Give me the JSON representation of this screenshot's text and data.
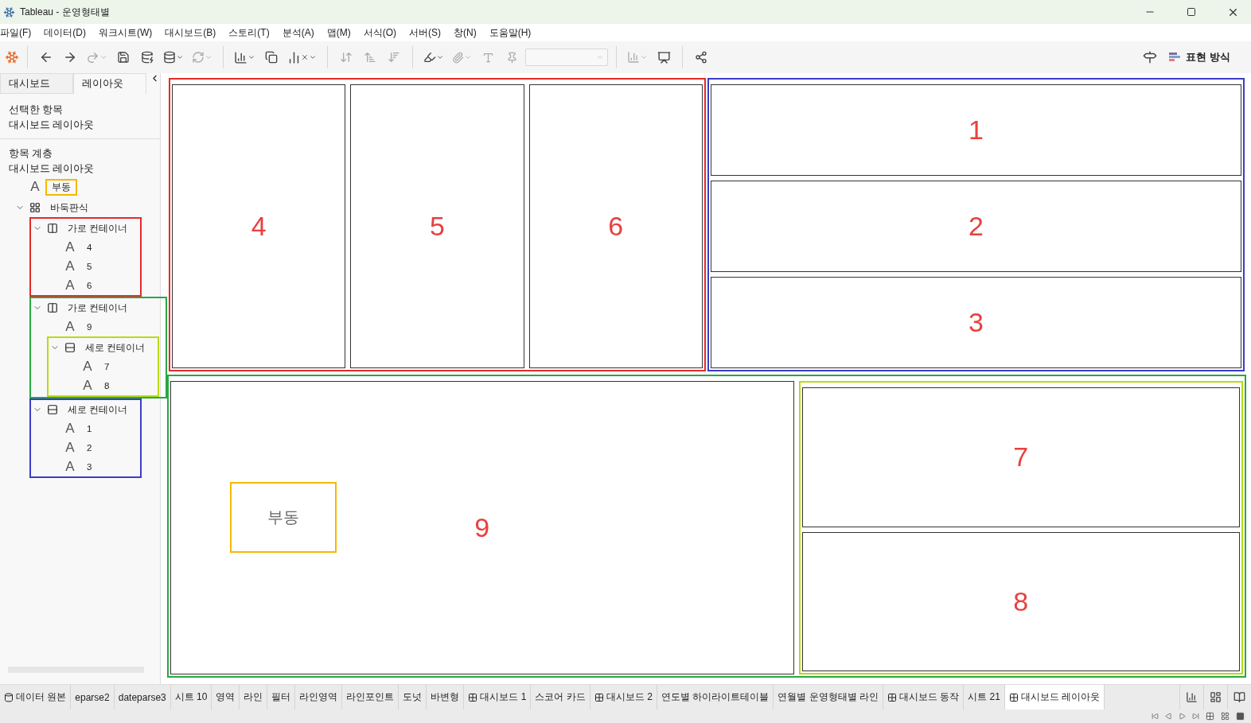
{
  "window": {
    "title": "Tableau - 운영형태별"
  },
  "menu": [
    "파일(F)",
    "데이터(D)",
    "워크시트(W)",
    "대시보드(B)",
    "스토리(T)",
    "분석(A)",
    "맵(M)",
    "서식(O)",
    "서버(S)",
    "창(N)",
    "도움말(H)"
  ],
  "toolbar": {
    "show_me": "표현 방식"
  },
  "sidebar": {
    "tabs": [
      {
        "label": "대시보드",
        "selected": false
      },
      {
        "label": "레이아웃",
        "selected": true
      }
    ],
    "selected_heading": "선택한 항목",
    "selected_value": "대시보드 레이아웃",
    "hierarchy_heading": "항목 계층",
    "hierarchy_root": "대시보드 레이아웃",
    "tree": [
      {
        "kind": "text",
        "icon": "A",
        "label": "부동",
        "color": "#f5b800"
      },
      {
        "kind": "tiled",
        "label": "바둑판식",
        "expanded": true,
        "children": [
          {
            "kind": "horizontal",
            "label": "가로 컨테이너",
            "expanded": true,
            "color": "#e52a2a",
            "children": [
              {
                "kind": "text",
                "icon": "A",
                "label": "4"
              },
              {
                "kind": "text",
                "icon": "A",
                "label": "5"
              },
              {
                "kind": "text",
                "icon": "A",
                "label": "6"
              }
            ]
          },
          {
            "kind": "horizontal",
            "label": "가로 컨테이너",
            "expanded": true,
            "color": "#27a844",
            "children": [
              {
                "kind": "text",
                "icon": "A",
                "label": "9"
              },
              {
                "kind": "vertical",
                "label": "세로 컨테이너",
                "expanded": true,
                "color": "#b6dc12",
                "children": [
                  {
                    "kind": "text",
                    "icon": "A",
                    "label": "7"
                  },
                  {
                    "kind": "text",
                    "icon": "A",
                    "label": "8"
                  }
                ]
              }
            ]
          },
          {
            "kind": "vertical",
            "label": "세로 컨테이너",
            "expanded": true,
            "color": "#3c3cc8",
            "children": [
              {
                "kind": "text",
                "icon": "A",
                "label": "1"
              },
              {
                "kind": "text",
                "icon": "A",
                "label": "2"
              },
              {
                "kind": "text",
                "icon": "A",
                "label": "3"
              }
            ]
          }
        ]
      }
    ]
  },
  "canvas": {
    "kind": "vertical",
    "children": [
      {
        "kind": "horizontal",
        "children": [
          {
            "kind": "horizontal",
            "color": "#e52a2a",
            "children": [
              {
                "kind": "zone",
                "label": "4"
              },
              {
                "kind": "zone",
                "label": "5"
              },
              {
                "kind": "zone",
                "label": "6"
              }
            ]
          },
          {
            "kind": "vertical",
            "color": "#3c3cc8",
            "children": [
              {
                "kind": "zone",
                "label": "1"
              },
              {
                "kind": "zone",
                "label": "2"
              },
              {
                "kind": "zone",
                "label": "3"
              }
            ]
          }
        ]
      },
      {
        "kind": "horizontal",
        "color": "#27a844",
        "children": [
          {
            "kind": "zone",
            "label": "9"
          },
          {
            "kind": "vertical",
            "color": "#b6dc12",
            "children": [
              {
                "kind": "zone",
                "label": "7"
              },
              {
                "kind": "zone",
                "label": "8"
              }
            ]
          }
        ]
      }
    ],
    "floating": {
      "label": "부동",
      "color": "#f5b800"
    }
  },
  "sheet_tabs": [
    {
      "kind": "datasource",
      "label": "데이터 원본",
      "selected": false
    },
    {
      "kind": "sheet",
      "label": "eparse2",
      "selected": false
    },
    {
      "kind": "sheet",
      "label": "dateparse3",
      "selected": false
    },
    {
      "kind": "sheet",
      "label": "시트 10",
      "selected": false
    },
    {
      "kind": "sheet",
      "label": "영역",
      "selected": false
    },
    {
      "kind": "sheet",
      "label": "라인",
      "selected": false
    },
    {
      "kind": "sheet",
      "label": "필터",
      "selected": false
    },
    {
      "kind": "sheet",
      "label": "라인영역",
      "selected": false
    },
    {
      "kind": "sheet",
      "label": "라인포인트",
      "selected": false
    },
    {
      "kind": "sheet",
      "label": "도넛",
      "selected": false
    },
    {
      "kind": "sheet",
      "label": "바변형",
      "selected": false
    },
    {
      "kind": "dashboard",
      "label": "대시보드 1",
      "selected": false
    },
    {
      "kind": "sheet",
      "label": "스코어 카드",
      "selected": false
    },
    {
      "kind": "dashboard",
      "label": "대시보드 2",
      "selected": false
    },
    {
      "kind": "sheet",
      "label": "연도별 하이라이트테이블",
      "selected": false
    },
    {
      "kind": "sheet",
      "label": "연월별 운영형태별 라인",
      "selected": false
    },
    {
      "kind": "dashboard",
      "label": "대시보드 동작",
      "selected": false
    },
    {
      "kind": "sheet",
      "label": "시트 21",
      "selected": false
    },
    {
      "kind": "dashboard",
      "label": "대시보드 레이아웃",
      "selected": true
    }
  ]
}
